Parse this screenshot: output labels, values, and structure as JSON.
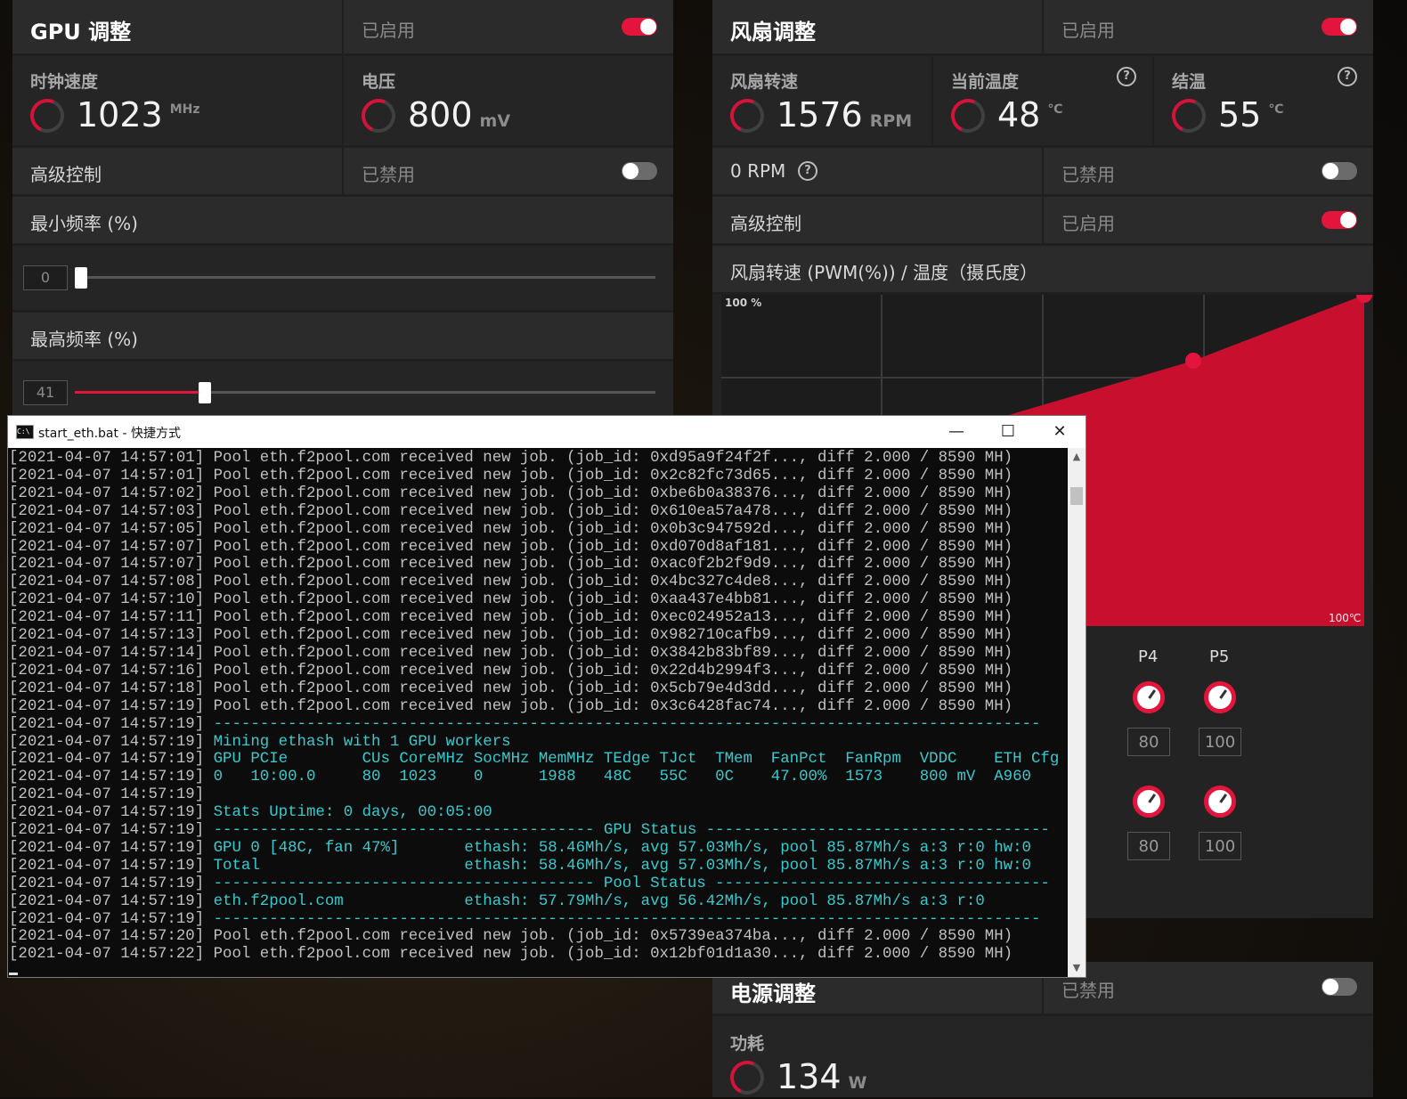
{
  "gpu": {
    "title": "GPU 调整",
    "status": "已启用",
    "toggle_on": true,
    "clock_label": "时钟速度",
    "clock_value": "1023",
    "clock_unit": "MHz",
    "voltage_label": "电压",
    "voltage_value": "800",
    "voltage_unit": "mV",
    "advanced_label": "高级控制",
    "advanced_status": "已禁用",
    "min_freq_label": "最小频率 (%)",
    "min_freq_value": "0",
    "min_freq_fraction": 0.0,
    "max_freq_label": "最高频率 (%)",
    "max_freq_value": "41",
    "max_freq_fraction": 0.41
  },
  "fan": {
    "title": "风扇调整",
    "status": "已启用",
    "speed_label": "风扇转速",
    "speed_value": "1576",
    "speed_unit": "RPM",
    "temp_label": "当前温度",
    "temp_value": "48",
    "temp_unit": "℃",
    "junction_label": "结温",
    "junction_value": "55",
    "junction_unit": "℃",
    "zero_rpm_label": "0 RPM",
    "zero_rpm_status": "已禁用",
    "advanced_label": "高级控制",
    "advanced_status": "已启用",
    "curve_title": "风扇转速 (PWM(%)) / 温度（摄氏度）",
    "curve_y_max": "100 %",
    "curve_x_max": "100℃",
    "p_labels": [
      "P4",
      "P5"
    ],
    "row1_values": [
      "80",
      "100"
    ],
    "row2_values": [
      "80",
      "100"
    ]
  },
  "power": {
    "title": "电源调整",
    "status": "已禁用",
    "draw_label": "功耗",
    "draw_value": "134",
    "draw_unit": "W"
  },
  "console": {
    "title": "start_eth.bat - 快捷方式",
    "lines": [
      {
        "ts": "[2021-04-07 14:57:01]",
        "msg": " Pool eth.f2pool.com received new job. (job_id: 0xd95a9f24f2f..., diff 2.000 / 8590 MH)",
        "c": false
      },
      {
        "ts": "[2021-04-07 14:57:01]",
        "msg": " Pool eth.f2pool.com received new job. (job_id: 0x2c82fc73d65..., diff 2.000 / 8590 MH)",
        "c": false
      },
      {
        "ts": "[2021-04-07 14:57:02]",
        "msg": " Pool eth.f2pool.com received new job. (job_id: 0xbe6b0a38376..., diff 2.000 / 8590 MH)",
        "c": false
      },
      {
        "ts": "[2021-04-07 14:57:03]",
        "msg": " Pool eth.f2pool.com received new job. (job_id: 0x610ea57a478..., diff 2.000 / 8590 MH)",
        "c": false
      },
      {
        "ts": "[2021-04-07 14:57:05]",
        "msg": " Pool eth.f2pool.com received new job. (job_id: 0x0b3c947592d..., diff 2.000 / 8590 MH)",
        "c": false
      },
      {
        "ts": "[2021-04-07 14:57:07]",
        "msg": " Pool eth.f2pool.com received new job. (job_id: 0xd070d8af181..., diff 2.000 / 8590 MH)",
        "c": false
      },
      {
        "ts": "[2021-04-07 14:57:07]",
        "msg": " Pool eth.f2pool.com received new job. (job_id: 0xac0f2b2f9d9..., diff 2.000 / 8590 MH)",
        "c": false
      },
      {
        "ts": "[2021-04-07 14:57:08]",
        "msg": " Pool eth.f2pool.com received new job. (job_id: 0x4bc327c4de8..., diff 2.000 / 8590 MH)",
        "c": false
      },
      {
        "ts": "[2021-04-07 14:57:10]",
        "msg": " Pool eth.f2pool.com received new job. (job_id: 0xaa437e4bb81..., diff 2.000 / 8590 MH)",
        "c": false
      },
      {
        "ts": "[2021-04-07 14:57:11]",
        "msg": " Pool eth.f2pool.com received new job. (job_id: 0xec024952a13..., diff 2.000 / 8590 MH)",
        "c": false
      },
      {
        "ts": "[2021-04-07 14:57:13]",
        "msg": " Pool eth.f2pool.com received new job. (job_id: 0x982710cafb9..., diff 2.000 / 8590 MH)",
        "c": false
      },
      {
        "ts": "[2021-04-07 14:57:14]",
        "msg": " Pool eth.f2pool.com received new job. (job_id: 0x3842b83bf89..., diff 2.000 / 8590 MH)",
        "c": false
      },
      {
        "ts": "[2021-04-07 14:57:16]",
        "msg": " Pool eth.f2pool.com received new job. (job_id: 0x22d4b2994f3..., diff 2.000 / 8590 MH)",
        "c": false
      },
      {
        "ts": "[2021-04-07 14:57:18]",
        "msg": " Pool eth.f2pool.com received new job. (job_id: 0x5cb79e4d3dd..., diff 2.000 / 8590 MH)",
        "c": false
      },
      {
        "ts": "[2021-04-07 14:57:19]",
        "msg": " Pool eth.f2pool.com received new job. (job_id: 0x3c6428fac74..., diff 2.000 / 8590 MH)",
        "c": false
      },
      {
        "ts": "[2021-04-07 14:57:19]",
        "msg": " -----------------------------------------------------------------------------------------",
        "c": true
      },
      {
        "ts": "[2021-04-07 14:57:19]",
        "msg": " Mining ethash with 1 GPU workers",
        "c": true
      },
      {
        "ts": "[2021-04-07 14:57:19]",
        "msg": " GPU PCIe        CUs CoreMHz SocMHz MemMHz TEdge TJct  TMem  FanPct  FanRpm  VDDC    ETH Cfg",
        "c": true
      },
      {
        "ts": "[2021-04-07 14:57:19]",
        "msg": " 0   10:00.0     80  1023    0      1988   48C   55C   0C    47.00%  1573    800 mV  A960",
        "c": true
      },
      {
        "ts": "[2021-04-07 14:57:19]",
        "msg": "",
        "c": true
      },
      {
        "ts": "[2021-04-07 14:57:19]",
        "msg": " Stats Uptime: 0 days, 00:05:00",
        "c": true
      },
      {
        "ts": "[2021-04-07 14:57:19]",
        "msg": " ----------------------------------------- GPU Status -------------------------------------",
        "c": true
      },
      {
        "ts": "[2021-04-07 14:57:19]",
        "msg": " GPU 0 [48C, fan 47%]       ethash: 58.46Mh/s, avg 57.03Mh/s, pool 85.87Mh/s a:3 r:0 hw:0",
        "c": true
      },
      {
        "ts": "[2021-04-07 14:57:19]",
        "msg": " Total                      ethash: 58.46Mh/s, avg 57.03Mh/s, pool 85.87Mh/s a:3 r:0 hw:0",
        "c": true
      },
      {
        "ts": "[2021-04-07 14:57:19]",
        "msg": " ----------------------------------------- Pool Status ------------------------------------",
        "c": true
      },
      {
        "ts": "[2021-04-07 14:57:19]",
        "msg": " eth.f2pool.com             ethash: 57.79Mh/s, avg 56.42Mh/s, pool 85.87Mh/s a:3 r:0",
        "c": true
      },
      {
        "ts": "[2021-04-07 14:57:19]",
        "msg": " -----------------------------------------------------------------------------------------",
        "c": true
      },
      {
        "ts": "[2021-04-07 14:57:20]",
        "msg": " Pool eth.f2pool.com received new job. (job_id: 0x5739ea374ba..., diff 2.000 / 8590 MH)",
        "c": false
      },
      {
        "ts": "[2021-04-07 14:57:22]",
        "msg": " Pool eth.f2pool.com received new job. (job_id: 0x12bf01d1a30..., diff 2.000 / 8590 MH)",
        "c": false
      }
    ]
  },
  "colors": {
    "accent": "#e3153c",
    "console_cyan": "#3ac9cc"
  }
}
